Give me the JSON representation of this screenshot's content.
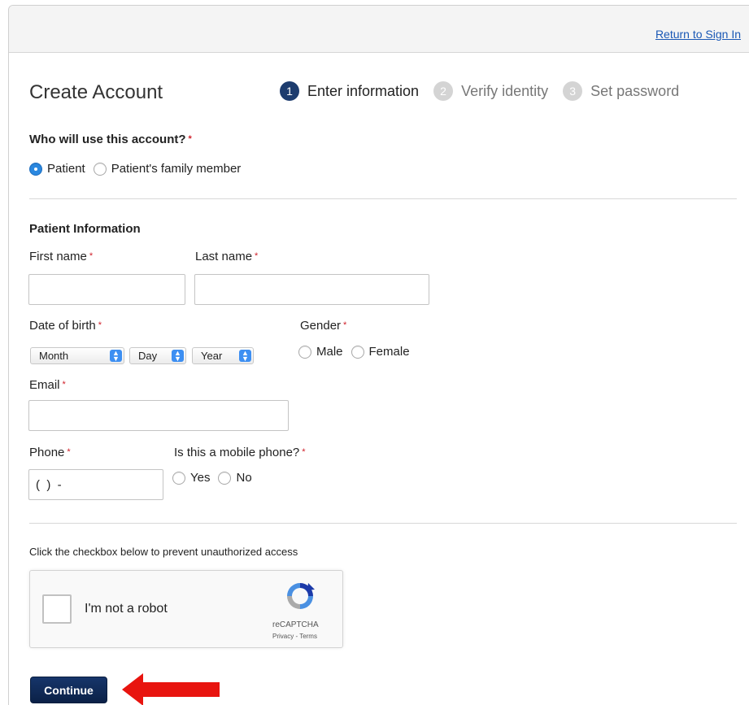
{
  "header": {
    "return_link": "Return to Sign In"
  },
  "page": {
    "title": "Create Account"
  },
  "steps": [
    {
      "number": "1",
      "label": "Enter information",
      "state": "active"
    },
    {
      "number": "2",
      "label": "Verify identity",
      "state": "inactive"
    },
    {
      "number": "3",
      "label": "Set password",
      "state": "inactive"
    }
  ],
  "who": {
    "question": "Who will use this account?",
    "required_mark": "*",
    "options": [
      {
        "label": "Patient",
        "checked": true
      },
      {
        "label": "Patient's family member",
        "checked": false
      }
    ]
  },
  "patient_info": {
    "heading": "Patient Information",
    "first_name": {
      "label": "First name",
      "value": ""
    },
    "last_name": {
      "label": "Last name",
      "value": ""
    },
    "dob": {
      "label": "Date of birth",
      "month": "Month",
      "day": "Day",
      "year": "Year"
    },
    "gender": {
      "label": "Gender",
      "options": [
        "Male",
        "Female"
      ]
    },
    "email": {
      "label": "Email",
      "value": ""
    },
    "phone": {
      "label": "Phone",
      "value": "(  )  -"
    },
    "mobile": {
      "label": "Is this a mobile phone?",
      "options": [
        "Yes",
        "No"
      ]
    }
  },
  "captcha": {
    "hint": "Click the checkbox below to prevent unauthorized access",
    "label": "I'm not a robot",
    "brand": "reCAPTCHA",
    "links": "Privacy - Terms"
  },
  "actions": {
    "continue": "Continue"
  },
  "colors": {
    "primary": "#1d3c6e",
    "link": "#1a58b5",
    "required": "#d0202a",
    "annotation_arrow": "#e8140f"
  }
}
